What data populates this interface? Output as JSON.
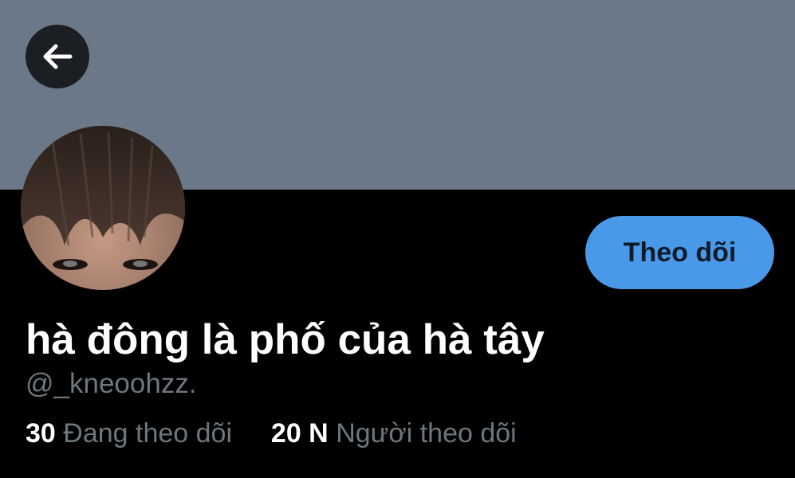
{
  "header": {
    "back_icon": "arrow-left-icon",
    "banner_color": "#6b7888"
  },
  "profile": {
    "display_name": "hà đông là phố của hà tây",
    "handle": "@_kneoohzz.",
    "avatar_icon": "avatar-photo"
  },
  "actions": {
    "follow_label": "Theo dõi",
    "accent_color": "#4a99e9"
  },
  "stats": {
    "following_count": "30",
    "following_label": "Đang theo dõi",
    "followers_count": "20 N",
    "followers_label": "Người theo dõi"
  }
}
